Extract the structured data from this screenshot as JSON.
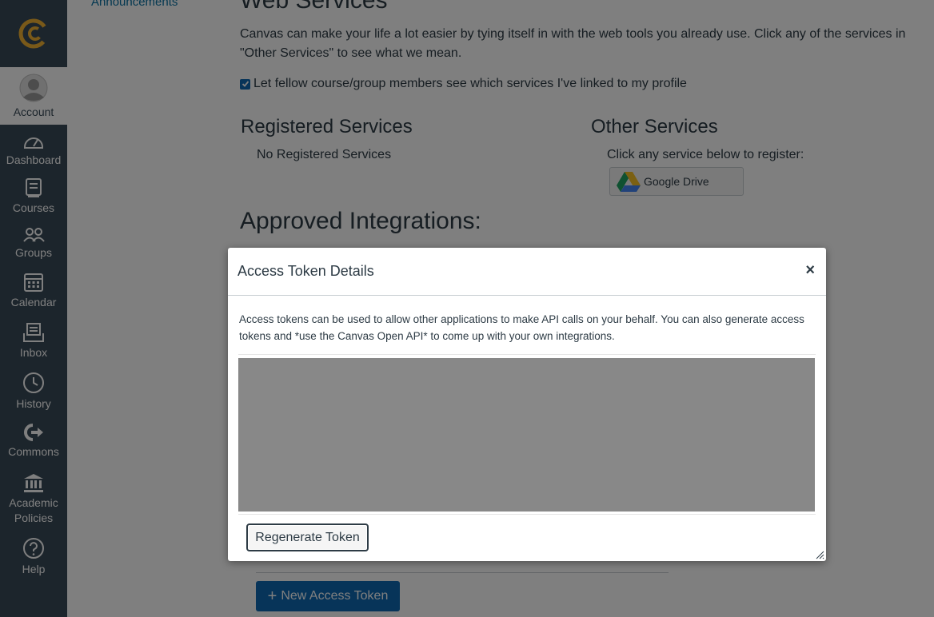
{
  "nav": {
    "items": [
      {
        "label": "Account",
        "icon": "avatar-icon"
      },
      {
        "label": "Dashboard",
        "icon": "dashboard-icon"
      },
      {
        "label": "Courses",
        "icon": "courses-icon"
      },
      {
        "label": "Groups",
        "icon": "groups-icon"
      },
      {
        "label": "Calendar",
        "icon": "calendar-icon"
      },
      {
        "label": "Inbox",
        "icon": "inbox-icon"
      },
      {
        "label": "History",
        "icon": "history-icon"
      },
      {
        "label": "Commons",
        "icon": "commons-icon"
      },
      {
        "label_line1": "Academic",
        "label_line2": "Policies",
        "icon": "academic-policies-icon"
      },
      {
        "label": "Help",
        "icon": "help-icon"
      }
    ],
    "brand_color": "#394b58",
    "logo_color": "#f2b233"
  },
  "sidebar": {
    "announcements_label": "Announcements"
  },
  "main": {
    "title": "Web Services",
    "intro": "Canvas can make your life a lot easier by tying itself in with the web tools you already use. Click any of the services in \"Other Services\" to see what we mean.",
    "checkbox_label": "Let fellow course/group members see which services I've linked to my profile",
    "checkbox_checked": true,
    "registered_title": "Registered Services",
    "registered_empty": "No Registered Services",
    "other_title": "Other Services",
    "other_hint": "Click any service below to register:",
    "google_drive_label": "Google Drive",
    "approved_title": "Approved Integrations:",
    "new_token_label": "New Access Token"
  },
  "dialog": {
    "title": "Access Token Details",
    "close_label": "×",
    "description": "Access tokens can be used to allow other applications to make API calls on your behalf. You can also generate access tokens and *use the Canvas Open API* to come up with your own integrations.",
    "regenerate_label": "Regenerate Token"
  },
  "colors": {
    "accent": "#0e68b3",
    "text": "#2d3b45",
    "redacted": "#888888"
  }
}
